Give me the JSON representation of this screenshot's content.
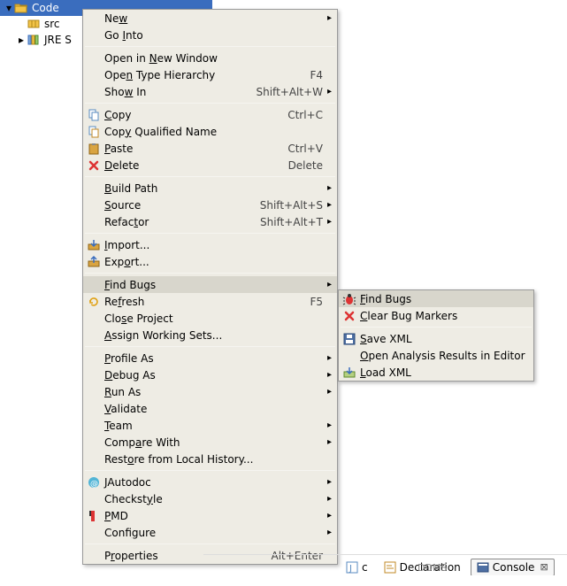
{
  "tree": {
    "root": {
      "label": "Code"
    },
    "children": [
      {
        "label": "src"
      },
      {
        "label": "JRE S"
      }
    ]
  },
  "context_menu": {
    "groups": [
      [
        {
          "label_pre": "Ne",
          "mn": "w",
          "label_post": "",
          "arrow": true
        },
        {
          "label_pre": "Go ",
          "mn": "I",
          "label_post": "nto"
        }
      ],
      [
        {
          "label_pre": "Open in ",
          "mn": "N",
          "label_post": "ew Window"
        },
        {
          "label_pre": "Ope",
          "mn": "n",
          "label_post": " Type Hierarchy",
          "accel": "F4"
        },
        {
          "label_pre": "Sho",
          "mn": "w",
          "label_post": " In",
          "accel": "Shift+Alt+W",
          "arrow": true
        }
      ],
      [
        {
          "icon": "copy-icon",
          "mn": "C",
          "label_post": "opy",
          "accel": "Ctrl+C"
        },
        {
          "icon": "copy-qual-icon",
          "label_pre": "Cop",
          "mn": "y",
          "label_post": " Qualified Name"
        },
        {
          "icon": "paste-icon",
          "mn": "P",
          "label_post": "aste",
          "accel": "Ctrl+V"
        },
        {
          "icon": "delete-icon",
          "mn": "D",
          "label_post": "elete",
          "accel": "Delete"
        }
      ],
      [
        {
          "mn": "B",
          "label_post": "uild Path",
          "arrow": true
        },
        {
          "mn": "S",
          "label_post": "ource",
          "accel": "Shift+Alt+S",
          "arrow": true
        },
        {
          "label_pre": "Refac",
          "mn": "t",
          "label_post": "or",
          "accel": "Shift+Alt+T",
          "arrow": true
        }
      ],
      [
        {
          "icon": "import-icon",
          "mn": "I",
          "label_post": "mport..."
        },
        {
          "icon": "export-icon",
          "label_pre": "Exp",
          "mn": "o",
          "label_post": "rt..."
        }
      ],
      [
        {
          "mn": "F",
          "label_post": "ind Bugs",
          "arrow": true,
          "highlight": true
        },
        {
          "icon": "refresh-icon",
          "label_pre": "Re",
          "mn": "f",
          "label_post": "resh",
          "accel": "F5"
        },
        {
          "label_pre": "Clo",
          "mn": "s",
          "label_post": "e Project"
        },
        {
          "mn": "A",
          "label_post": "ssign Working Sets..."
        }
      ],
      [
        {
          "mn": "P",
          "label_post": "rofile As",
          "arrow": true
        },
        {
          "mn": "D",
          "label_post": "ebug As",
          "arrow": true
        },
        {
          "mn": "R",
          "label_post": "un As",
          "arrow": true
        },
        {
          "mn": "V",
          "label_post": "alidate"
        },
        {
          "mn": "T",
          "label_post": "eam",
          "arrow": true
        },
        {
          "label_pre": "Comp",
          "mn": "a",
          "label_post": "re With",
          "arrow": true
        },
        {
          "label_pre": "Rest",
          "mn": "o",
          "label_post": "re from Local History..."
        }
      ],
      [
        {
          "icon": "jautodoc-icon",
          "mn": "J",
          "label_post": "Autodoc",
          "arrow": true
        },
        {
          "label_pre": "Checkst",
          "mn": "y",
          "label_post": "le",
          "arrow": true
        },
        {
          "icon": "pmd-icon",
          "mn": "P",
          "label_post": "MD",
          "arrow": true
        },
        {
          "label_pre": "Confi",
          "mn": "g",
          "label_post": "ure",
          "arrow": true
        }
      ],
      [
        {
          "label_pre": "P",
          "mn": "r",
          "label_post": "operties",
          "accel": "Alt+Enter"
        }
      ]
    ]
  },
  "submenu": {
    "groups": [
      [
        {
          "icon": "bug-icon",
          "mn": "F",
          "label_post": "ind Bugs",
          "highlight": true
        },
        {
          "icon": "delete-icon",
          "mn": "C",
          "label_post": "lear Bug Markers"
        }
      ],
      [
        {
          "icon": "save-icon",
          "mn": "S",
          "label_post": "ave XML"
        },
        {
          "label_pre": "",
          "mn": "O",
          "label_post": "pen Analysis Results in Editor"
        },
        {
          "icon": "load-icon",
          "mn": "L",
          "label_post": "oad XML"
        }
      ]
    ]
  },
  "bottom_tabs": {
    "partial": "DDMS",
    "tabs": [
      {
        "label": "c",
        "icon": "javadoc-icon"
      },
      {
        "label": "Declaration",
        "icon": "decl-icon"
      },
      {
        "label": "Console",
        "icon": "console-icon",
        "active": true,
        "badge": true
      }
    ]
  }
}
